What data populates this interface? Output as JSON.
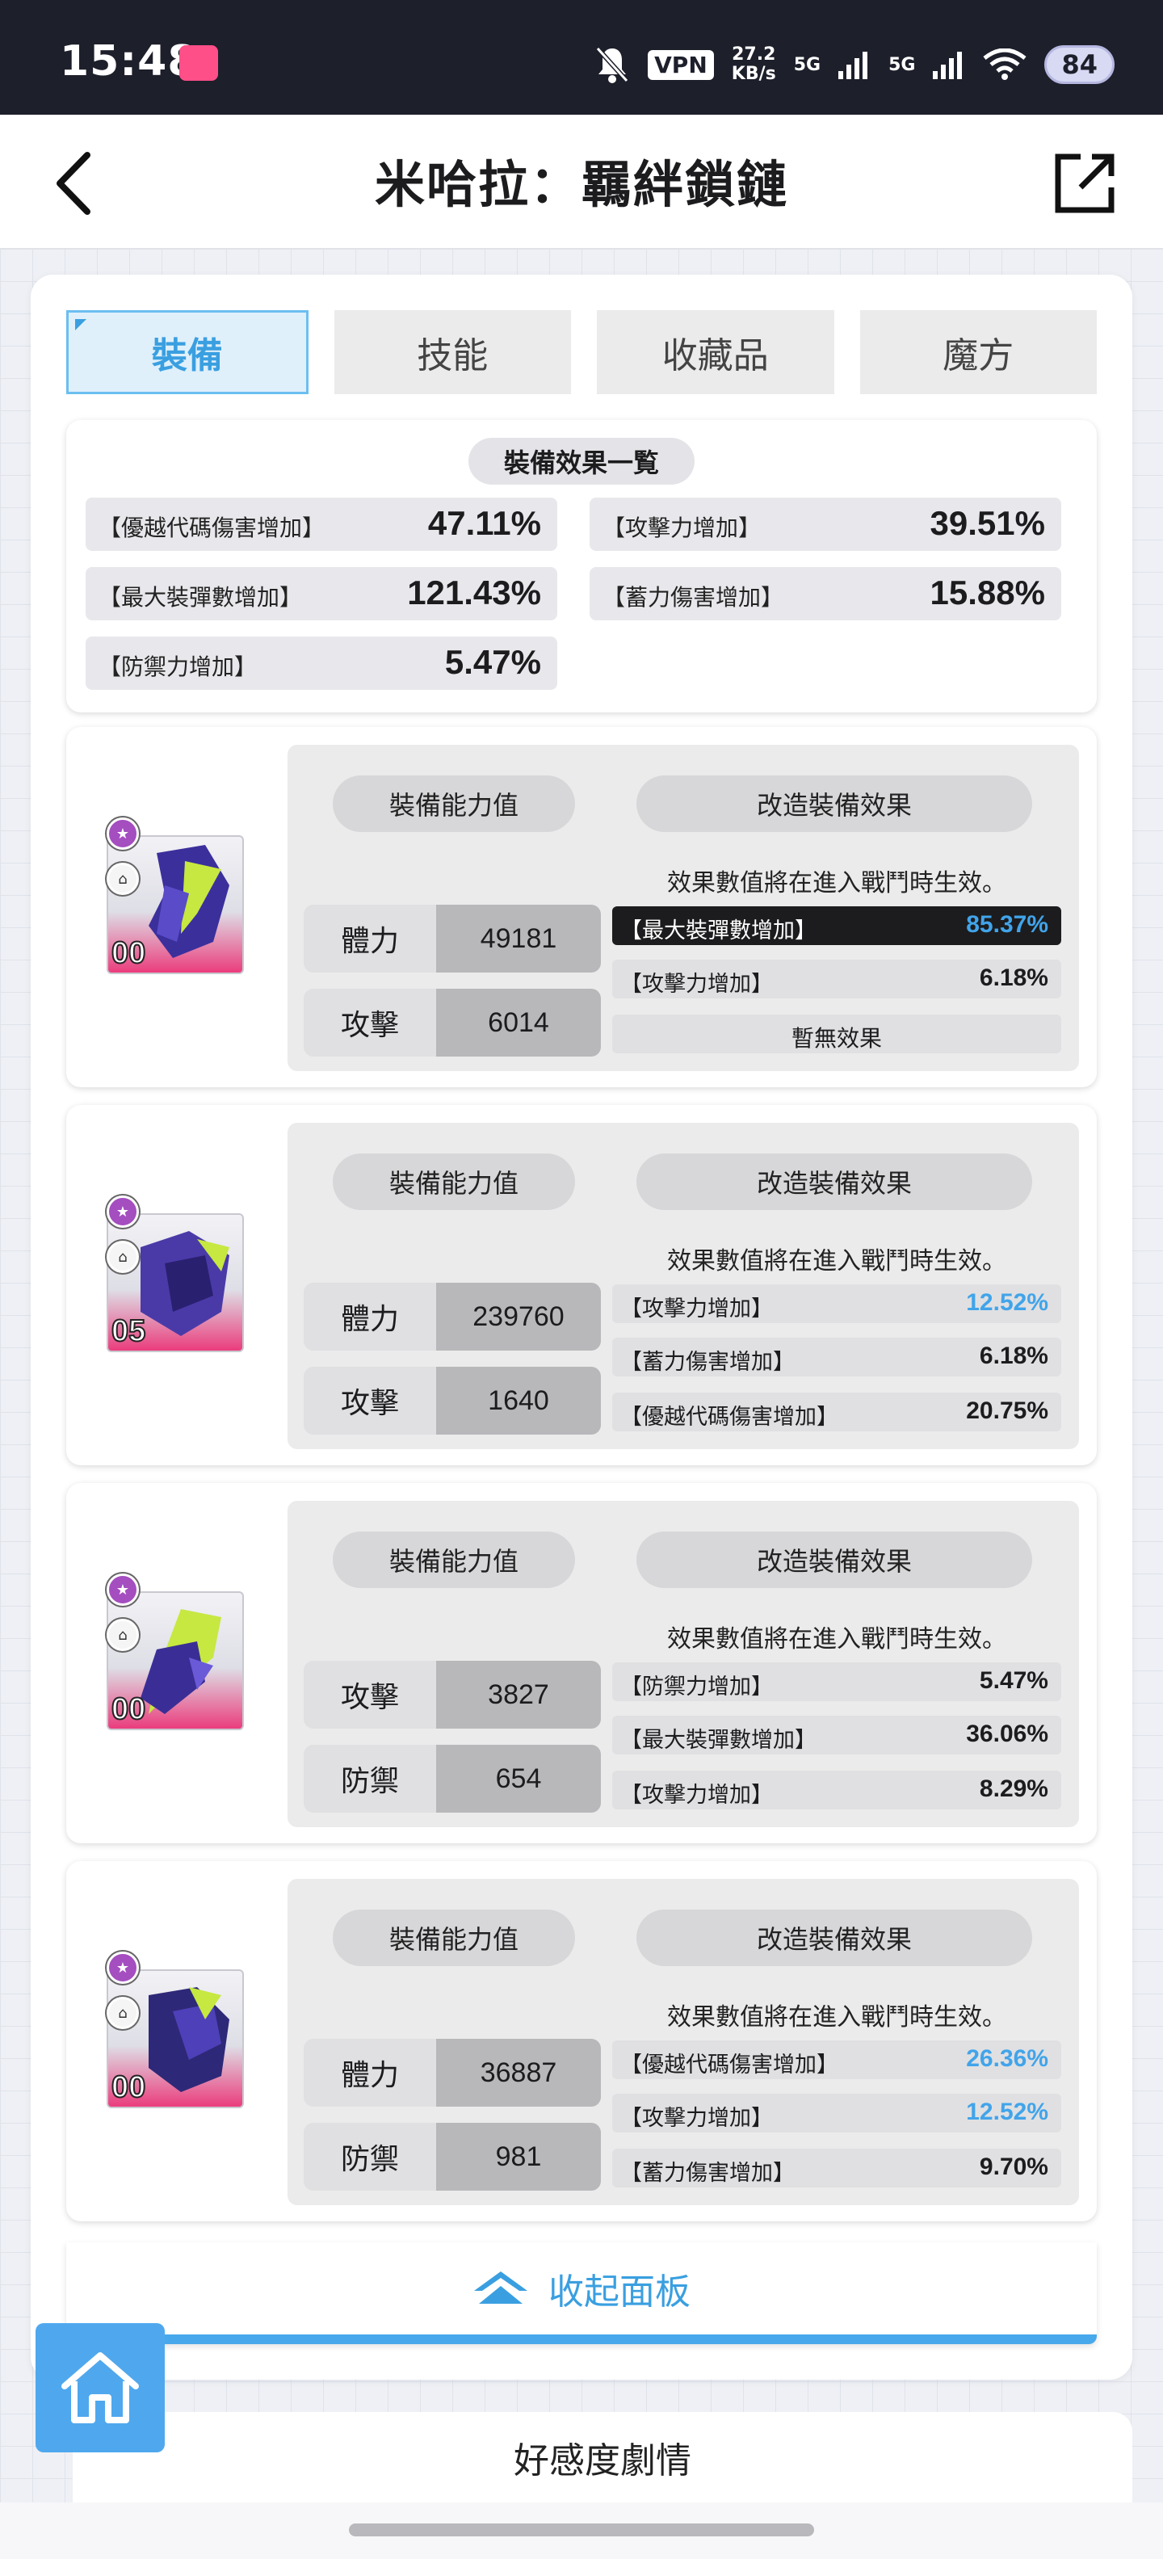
{
  "status_bar": {
    "time": "15:48",
    "vpn": "VPN",
    "speed_value": "27.2",
    "speed_unit": "KB/s",
    "signal1": "5G",
    "signal2": "5G",
    "battery": "84",
    "icons": [
      "bilibili-app-icon",
      "mute-bell-icon",
      "signal-icon",
      "wifi-icon"
    ]
  },
  "header": {
    "title": "米哈拉：羈絆鎖鏈",
    "back_icon": "chevron-left-icon",
    "share_icon": "external-link-icon"
  },
  "tabs": [
    {
      "label": "裝備",
      "active": true
    },
    {
      "label": "技能",
      "active": false
    },
    {
      "label": "收藏品",
      "active": false
    },
    {
      "label": "魔方",
      "active": false
    }
  ],
  "summary": {
    "title": "裝備效果一覧",
    "rows": [
      {
        "label": "【優越代碼傷害增加】",
        "value": "47.11%"
      },
      {
        "label": "【攻擊力增加】",
        "value": "39.51%"
      },
      {
        "label": "【最大裝彈數增加】",
        "value": "121.43%"
      },
      {
        "label": "【蓄力傷害增加】",
        "value": "15.88%"
      },
      {
        "label": "【防禦力增加】",
        "value": "5.47%"
      }
    ]
  },
  "equipment_common": {
    "stats_title": "裝備能力值",
    "mods_title": "改造裝備效果",
    "effect_note": "效果數值將在進入戰鬥時生效。"
  },
  "equipment": [
    {
      "level": "00",
      "accent": "#3b2f9c",
      "stats": [
        {
          "name": "體力",
          "value": "49181"
        },
        {
          "name": "攻擊",
          "value": "6014"
        }
      ],
      "mods": [
        {
          "label": "【最大裝彈數增加】",
          "value": "85.37%",
          "highlight": true,
          "blue": true
        },
        {
          "label": "【攻擊力增加】",
          "value": "6.18%",
          "highlight": false,
          "blue": false
        },
        {
          "label": "暫無效果",
          "value": "",
          "none": true
        }
      ]
    },
    {
      "level": "05",
      "accent": "#4a3aa8",
      "stats": [
        {
          "name": "體力",
          "value": "239760"
        },
        {
          "name": "攻擊",
          "value": "1640"
        }
      ],
      "mods": [
        {
          "label": "【攻擊力增加】",
          "value": "12.52%",
          "highlight": false,
          "blue": true
        },
        {
          "label": "【蓄力傷害增加】",
          "value": "6.18%",
          "highlight": false,
          "blue": false
        },
        {
          "label": "【優越代碼傷害增加】",
          "value": "20.75%",
          "highlight": false,
          "blue": false
        }
      ]
    },
    {
      "level": "00",
      "accent": "#3a2e96",
      "stats": [
        {
          "name": "攻擊",
          "value": "3827"
        },
        {
          "name": "防禦",
          "value": "654"
        }
      ],
      "mods": [
        {
          "label": "【防禦力增加】",
          "value": "5.47%",
          "highlight": false,
          "blue": false
        },
        {
          "label": "【最大裝彈數增加】",
          "value": "36.06%",
          "highlight": false,
          "blue": false
        },
        {
          "label": "【攻擊力增加】",
          "value": "8.29%",
          "highlight": false,
          "blue": false
        }
      ]
    },
    {
      "level": "00",
      "accent": "#2e2878",
      "stats": [
        {
          "name": "體力",
          "value": "36887"
        },
        {
          "name": "防禦",
          "value": "981"
        }
      ],
      "mods": [
        {
          "label": "【優越代碼傷害增加】",
          "value": "26.36%",
          "highlight": false,
          "blue": true
        },
        {
          "label": "【攻擊力增加】",
          "value": "12.52%",
          "highlight": false,
          "blue": true
        },
        {
          "label": "【蓄力傷害增加】",
          "value": "9.70%",
          "highlight": false,
          "blue": false
        }
      ]
    }
  ],
  "collapse": {
    "label": "收起面板",
    "icon": "double-chevron-up-icon"
  },
  "home_button": {
    "icon": "home-icon"
  },
  "favor": {
    "label": "好感度劇情"
  },
  "colors": {
    "accent_blue": "#41a4ea",
    "status_bar": "#1d1f2b"
  }
}
